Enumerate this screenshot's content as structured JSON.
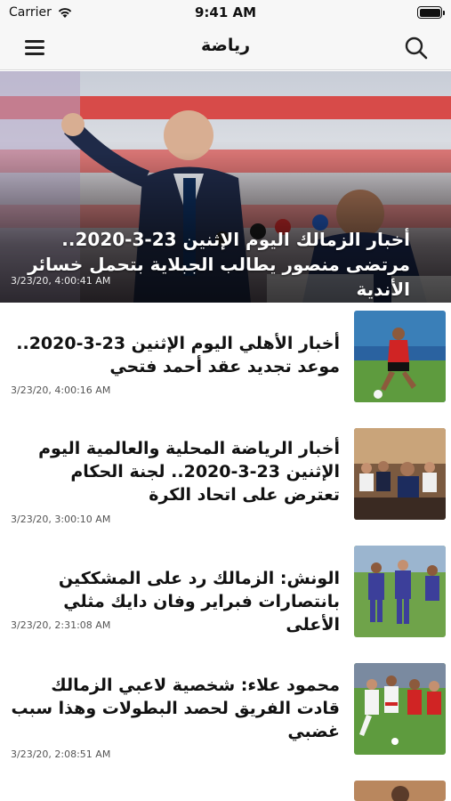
{
  "status_bar": {
    "carrier": "Carrier",
    "time": "9:41 AM",
    "wifi_icon": "wifi-icon",
    "battery_icon": "battery-icon"
  },
  "nav": {
    "title": "رياضة",
    "menu_icon": "hamburger-menu-icon",
    "search_icon": "search-icon"
  },
  "featured": {
    "title": "أخبار الزمالك اليوم الإثنين 23-3-2020.. مرتضى منصور يطالب الجبلاية بتحمل خسائر الأندية",
    "date": "3/23/20, 4:00:41 AM"
  },
  "articles": [
    {
      "title": "أخبار الأهلي اليوم الإثنين 23-3-2020.. موعد تجديد عقد أحمد فتحي",
      "date": "3/23/20, 4:00:16 AM"
    },
    {
      "title": "أخبار الرياضة المحلية والعالمية اليوم الإثنين 23-3-2020.. لجنة الحكام تعترض على اتحاد الكرة",
      "date": "3/23/20, 3:00:10 AM"
    },
    {
      "title": "الونش: الزمالك رد على المشككين بانتصارات فبراير وفان دايك مثلي الأعلى",
      "date": "3/23/20, 2:31:08 AM"
    },
    {
      "title": "محمود علاء: شخصية لاعبي الزمالك قادت الفريق لحصد البطولات وهذا سبب غضبي",
      "date": "3/23/20, 2:08:51 AM"
    }
  ]
}
